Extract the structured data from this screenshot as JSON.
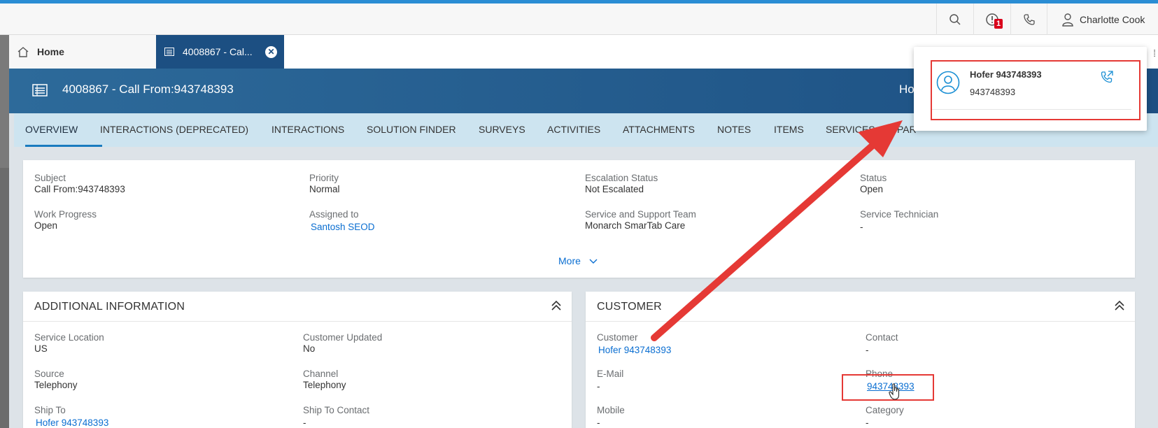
{
  "shellbar": {
    "alert_count": "1",
    "user_name": "Charlotte Cook"
  },
  "tabs": {
    "home_label": "Home",
    "record_label": "4008867 - Cal..."
  },
  "header": {
    "title": "4008867 - Call From:943748393",
    "right_text": "Ho"
  },
  "subtabs": [
    "OVERVIEW",
    "INTERACTIONS (DEPRECATED)",
    "INTERACTIONS",
    "SOLUTION FINDER",
    "SURVEYS",
    "ACTIVITIES",
    "ATTACHMENTS",
    "NOTES",
    "ITEMS",
    "SERVICES",
    "PAR"
  ],
  "overview": {
    "subject_label": "Subject",
    "subject_value": "Call From:943748393",
    "priority_label": "Priority",
    "priority_value": "Normal",
    "escalation_label": "Escalation Status",
    "escalation_value": "Not Escalated",
    "status_label": "Status",
    "status_value": "Open",
    "progress_label": "Work Progress",
    "progress_value": "Open",
    "assigned_label": "Assigned to",
    "assigned_value": "Santosh SEOD",
    "team_label": "Service and Support Team",
    "team_value": "Monarch SmarTab Care",
    "technician_label": "Service Technician",
    "technician_value": "-",
    "more_label": "More"
  },
  "additional": {
    "title": "ADDITIONAL INFORMATION",
    "location_label": "Service Location",
    "location_value": "US",
    "updated_label": "Customer Updated",
    "updated_value": "No",
    "source_label": "Source",
    "source_value": "Telephony",
    "channel_label": "Channel",
    "channel_value": "Telephony",
    "shipto_label": "Ship To",
    "shipto_value": "Hofer 943748393",
    "shiptocontact_label": "Ship To Contact",
    "shiptocontact_value": "-"
  },
  "customer": {
    "title": "CUSTOMER",
    "customer_label": "Customer",
    "customer_value": "Hofer 943748393",
    "contact_label": "Contact",
    "contact_value": "-",
    "email_label": "E-Mail",
    "email_value": "-",
    "phone_label": "Phone",
    "phone_value": "943748393",
    "mobile_label": "Mobile",
    "mobile_value": "-",
    "category_label": "Category",
    "category_value": "-"
  },
  "popover": {
    "name": "Hofer 943748393",
    "number": "943748393"
  },
  "colors": {
    "accent": "#1a7bbf",
    "header": "#1c4f82",
    "subtab_bg": "#cde4f0",
    "annotation_red": "#e53935"
  }
}
